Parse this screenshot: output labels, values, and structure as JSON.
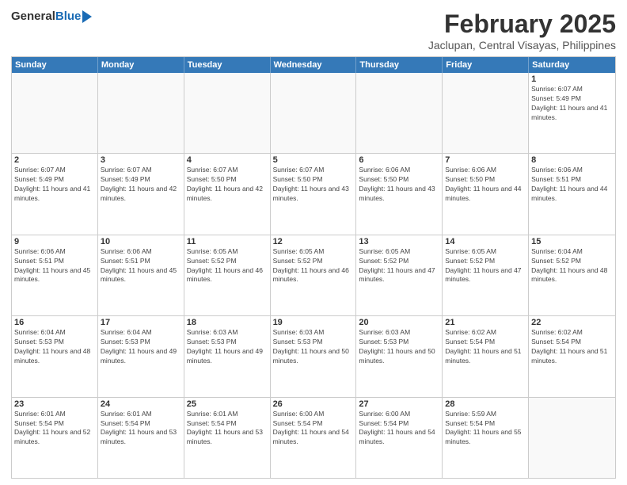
{
  "logo": {
    "general": "General",
    "blue": "Blue"
  },
  "title": "February 2025",
  "location": "Jaclupan, Central Visayas, Philippines",
  "header_days": [
    "Sunday",
    "Monday",
    "Tuesday",
    "Wednesday",
    "Thursday",
    "Friday",
    "Saturday"
  ],
  "weeks": [
    [
      {
        "day": "",
        "info": ""
      },
      {
        "day": "",
        "info": ""
      },
      {
        "day": "",
        "info": ""
      },
      {
        "day": "",
        "info": ""
      },
      {
        "day": "",
        "info": ""
      },
      {
        "day": "",
        "info": ""
      },
      {
        "day": "1",
        "info": "Sunrise: 6:07 AM\nSunset: 5:49 PM\nDaylight: 11 hours and 41 minutes."
      }
    ],
    [
      {
        "day": "2",
        "info": "Sunrise: 6:07 AM\nSunset: 5:49 PM\nDaylight: 11 hours and 41 minutes."
      },
      {
        "day": "3",
        "info": "Sunrise: 6:07 AM\nSunset: 5:49 PM\nDaylight: 11 hours and 42 minutes."
      },
      {
        "day": "4",
        "info": "Sunrise: 6:07 AM\nSunset: 5:50 PM\nDaylight: 11 hours and 42 minutes."
      },
      {
        "day": "5",
        "info": "Sunrise: 6:07 AM\nSunset: 5:50 PM\nDaylight: 11 hours and 43 minutes."
      },
      {
        "day": "6",
        "info": "Sunrise: 6:06 AM\nSunset: 5:50 PM\nDaylight: 11 hours and 43 minutes."
      },
      {
        "day": "7",
        "info": "Sunrise: 6:06 AM\nSunset: 5:50 PM\nDaylight: 11 hours and 44 minutes."
      },
      {
        "day": "8",
        "info": "Sunrise: 6:06 AM\nSunset: 5:51 PM\nDaylight: 11 hours and 44 minutes."
      }
    ],
    [
      {
        "day": "9",
        "info": "Sunrise: 6:06 AM\nSunset: 5:51 PM\nDaylight: 11 hours and 45 minutes."
      },
      {
        "day": "10",
        "info": "Sunrise: 6:06 AM\nSunset: 5:51 PM\nDaylight: 11 hours and 45 minutes."
      },
      {
        "day": "11",
        "info": "Sunrise: 6:05 AM\nSunset: 5:52 PM\nDaylight: 11 hours and 46 minutes."
      },
      {
        "day": "12",
        "info": "Sunrise: 6:05 AM\nSunset: 5:52 PM\nDaylight: 11 hours and 46 minutes."
      },
      {
        "day": "13",
        "info": "Sunrise: 6:05 AM\nSunset: 5:52 PM\nDaylight: 11 hours and 47 minutes."
      },
      {
        "day": "14",
        "info": "Sunrise: 6:05 AM\nSunset: 5:52 PM\nDaylight: 11 hours and 47 minutes."
      },
      {
        "day": "15",
        "info": "Sunrise: 6:04 AM\nSunset: 5:52 PM\nDaylight: 11 hours and 48 minutes."
      }
    ],
    [
      {
        "day": "16",
        "info": "Sunrise: 6:04 AM\nSunset: 5:53 PM\nDaylight: 11 hours and 48 minutes."
      },
      {
        "day": "17",
        "info": "Sunrise: 6:04 AM\nSunset: 5:53 PM\nDaylight: 11 hours and 49 minutes."
      },
      {
        "day": "18",
        "info": "Sunrise: 6:03 AM\nSunset: 5:53 PM\nDaylight: 11 hours and 49 minutes."
      },
      {
        "day": "19",
        "info": "Sunrise: 6:03 AM\nSunset: 5:53 PM\nDaylight: 11 hours and 50 minutes."
      },
      {
        "day": "20",
        "info": "Sunrise: 6:03 AM\nSunset: 5:53 PM\nDaylight: 11 hours and 50 minutes."
      },
      {
        "day": "21",
        "info": "Sunrise: 6:02 AM\nSunset: 5:54 PM\nDaylight: 11 hours and 51 minutes."
      },
      {
        "day": "22",
        "info": "Sunrise: 6:02 AM\nSunset: 5:54 PM\nDaylight: 11 hours and 51 minutes."
      }
    ],
    [
      {
        "day": "23",
        "info": "Sunrise: 6:01 AM\nSunset: 5:54 PM\nDaylight: 11 hours and 52 minutes."
      },
      {
        "day": "24",
        "info": "Sunrise: 6:01 AM\nSunset: 5:54 PM\nDaylight: 11 hours and 53 minutes."
      },
      {
        "day": "25",
        "info": "Sunrise: 6:01 AM\nSunset: 5:54 PM\nDaylight: 11 hours and 53 minutes."
      },
      {
        "day": "26",
        "info": "Sunrise: 6:00 AM\nSunset: 5:54 PM\nDaylight: 11 hours and 54 minutes."
      },
      {
        "day": "27",
        "info": "Sunrise: 6:00 AM\nSunset: 5:54 PM\nDaylight: 11 hours and 54 minutes."
      },
      {
        "day": "28",
        "info": "Sunrise: 5:59 AM\nSunset: 5:54 PM\nDaylight: 11 hours and 55 minutes."
      },
      {
        "day": "",
        "info": ""
      }
    ]
  ]
}
